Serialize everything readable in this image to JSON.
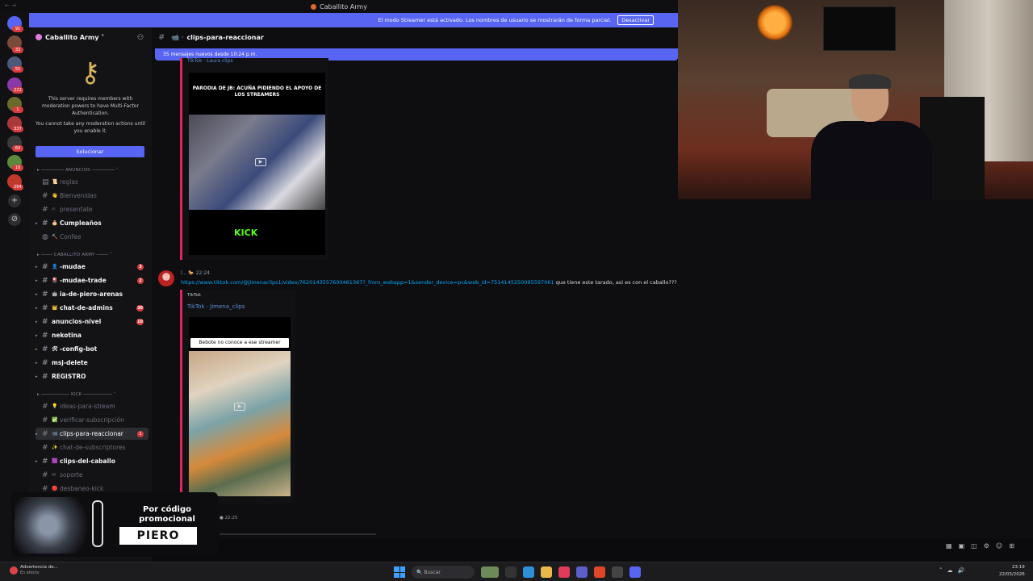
{
  "window": {
    "title": "Caballito Army"
  },
  "streamer_banner": {
    "text": "El modo Streamer está activado. Los nombres de usuario se mostrarán de forma parcial.",
    "button": "Desactivar"
  },
  "server": {
    "name": "Caballito Army ˅",
    "mfa_text": "This server requires members with moderation powers to have Multi-Factor Authentication.",
    "mfa_subtext": "You cannot take any moderation actions until you enable it.",
    "mfa_button": "Solucionar"
  },
  "rail_badges": [
    "91",
    "33",
    "55",
    "222",
    "1",
    "337",
    "64",
    "10",
    "264"
  ],
  "categories": {
    "anuncios": "ANUNCIOS",
    "army": "CABALLITO ARMY",
    "kick": "KICK"
  },
  "channels": {
    "reglas": "reglas",
    "bienvenidas": "Bienvenidas",
    "presentate": "presentate",
    "cumpleanos": "Cumpleaños",
    "confee": "Confee",
    "mudae": "-mudae",
    "mudae_trade": "-mudae-trade",
    "ia": "ia-de-piero-arenas",
    "chat_admins": "chat-de-admins",
    "anuncios_nivel": "anuncios-nivel",
    "nekotina": "nekotina",
    "config_bot": "-config-bot",
    "msj_delete": "msj-delete",
    "registro": "REGISTRO",
    "ideas": "ideas-para-stream",
    "verificar": "verificar-subscripción",
    "clips": "clips-para-reaccionar",
    "chat_subs": "chat-de-subscriptores",
    "clips_caballo": "clips-del-caballo",
    "soporte": "soporte",
    "desbaneo": "desbaneo-kick"
  },
  "channel_counts": {
    "mudae": "3",
    "mudae_trade": "2",
    "chat_admins": "30",
    "anuncios_nivel": "10",
    "clips": "1"
  },
  "chat": {
    "channel": "clips-para-reaccionar",
    "new_messages": "35 mensajes nuevos desde 10:24 p.m.",
    "embed1_source": "TikTok · Laura clips",
    "embed1_caption": "PARODIA DE JB: ACUÑA PIDIENDO EL APOYO DE LOS STREAMERS",
    "embed1_brand": "KICK",
    "msg_time": "22:24",
    "msg_link": "https://www.tiktok.com/@jimenaclips1/video/7620143557600461367?_from_webapp=1&sender_device=pc&web_id=7514145250095597061",
    "msg_text": " que tiene este tarado, asi es con el caballo???",
    "embed2_provider": "TikTok",
    "embed2_author": "TikTok · Jimena_clips",
    "embed2_caption": "Bebote no conoce a ese streamer",
    "msg2_time": "22:25"
  },
  "promo": {
    "line": "Por código promocional",
    "code": "PIERO"
  },
  "taskbar": {
    "warn_title": "Advertencia de...",
    "warn_sub": "En efecto",
    "search": "Buscar",
    "time": "23:19",
    "date": "22/03/2026"
  }
}
